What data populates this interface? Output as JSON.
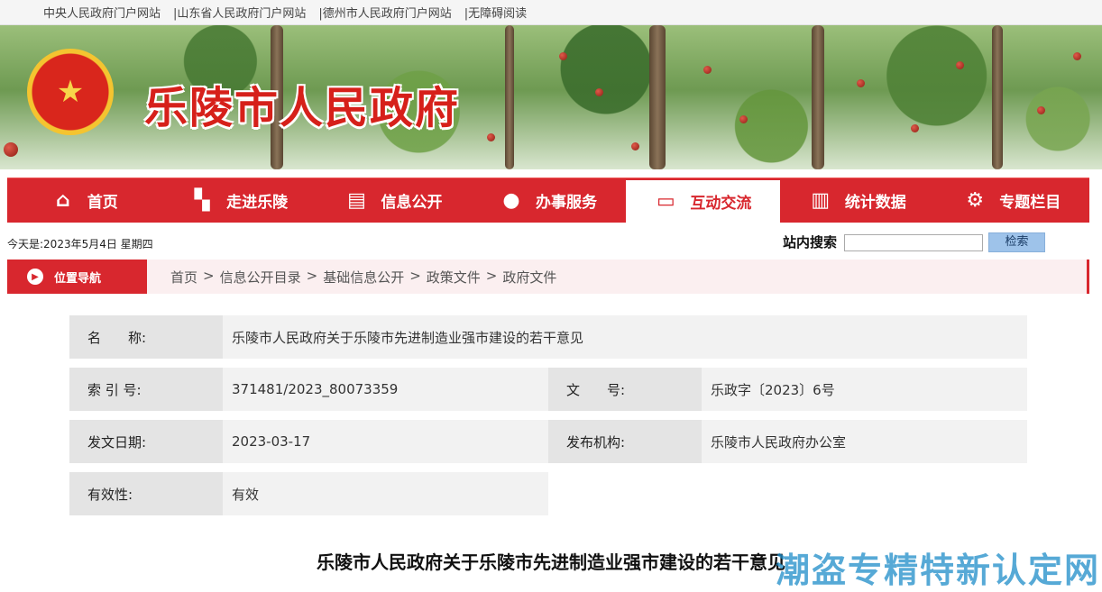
{
  "toplinks": [
    "中央人民政府门户网站",
    "|山东省人民政府门户网站",
    "|德州市人民政府门户网站",
    "|无障碍阅读"
  ],
  "banner": {
    "title": "乐陵市人民政府"
  },
  "nav": [
    {
      "label": "首页",
      "icon": "home-icon"
    },
    {
      "label": "走进乐陵",
      "icon": "map-icon"
    },
    {
      "label": "信息公开",
      "icon": "document-icon"
    },
    {
      "label": "办事服务",
      "icon": "user-icon"
    },
    {
      "label": "互动交流",
      "icon": "chat-icon",
      "active": true
    },
    {
      "label": "统计数据",
      "icon": "bar-chart-icon"
    },
    {
      "label": "专题栏目",
      "icon": "gear-icon"
    }
  ],
  "date_text": "今天是:2023年5月4日 星期四",
  "search": {
    "label": "站内搜索",
    "value": "",
    "button": "检索"
  },
  "breadcrumb": {
    "label": "位置导航",
    "items": [
      "首页",
      "信息公开目录",
      "基础信息公开",
      "政策文件",
      "政府文件"
    ]
  },
  "info": {
    "name_key": "名　　称:",
    "name_value": "乐陵市人民政府关于乐陵市先进制造业强市建设的若干意见",
    "index_key": "索 引 号:",
    "index_value": "371481/2023_80073359",
    "docno_key": "文　　号:",
    "docno_value": "乐政字〔2023〕6号",
    "date_key": "发文日期:",
    "date_value": "2023-03-17",
    "org_key": "发布机构:",
    "org_value": "乐陵市人民政府办公室",
    "valid_key": "有效性:",
    "valid_value": "有效"
  },
  "doc_title": "乐陵市人民政府关于乐陵市先进制造业强市建设的若干意见",
  "watermark": "潮盗专精特新认定网",
  "colors": {
    "primary_red": "#d8272e",
    "search_button": "#9ec3ea"
  }
}
